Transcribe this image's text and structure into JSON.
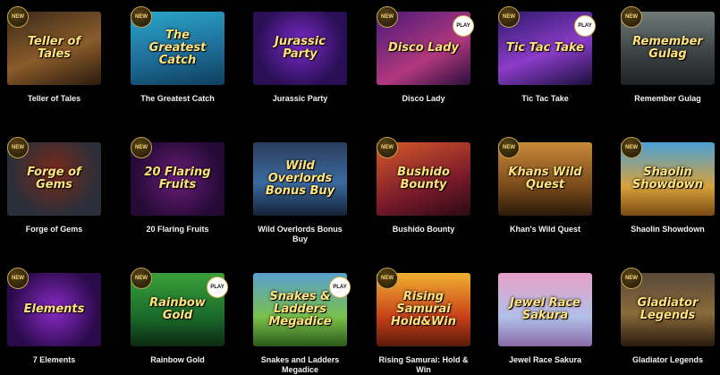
{
  "badges": {
    "new": "NEW",
    "play": "PLAY"
  },
  "games": [
    {
      "name": "Teller of Tales",
      "art_text": "Teller of Tales",
      "new": true,
      "play": false
    },
    {
      "name": "The Greatest Catch",
      "art_text": "The Greatest Catch",
      "new": true,
      "play": false
    },
    {
      "name": "Jurassic Party",
      "art_text": "Jurassic Party",
      "new": false,
      "play": false
    },
    {
      "name": "Disco Lady",
      "art_text": "Disco Lady",
      "new": true,
      "play": true
    },
    {
      "name": "Tic Tac Take",
      "art_text": "Tic Tac Take",
      "new": true,
      "play": true
    },
    {
      "name": "Remember Gulag",
      "art_text": "Remember Gulag",
      "new": true,
      "play": false
    },
    {
      "name": "Forge of Gems",
      "art_text": "Forge of Gems",
      "new": true,
      "play": false
    },
    {
      "name": "20 Flaring Fruits",
      "art_text": "20 Flaring Fruits",
      "new": true,
      "play": false
    },
    {
      "name": "Wild Overlords Bonus Buy",
      "art_text": "Wild Overlords Bonus Buy",
      "new": false,
      "play": false
    },
    {
      "name": "Bushido Bounty",
      "art_text": "Bushido Bounty",
      "new": true,
      "play": false
    },
    {
      "name": "Khan's Wild Quest",
      "art_text": "Khans Wild Quest",
      "new": true,
      "play": false
    },
    {
      "name": "Shaolin Showdown",
      "art_text": "Shaolin Showdown",
      "new": true,
      "play": false
    },
    {
      "name": "7 Elements",
      "art_text": "Elements",
      "new": true,
      "play": false
    },
    {
      "name": "Rainbow Gold",
      "art_text": "Rainbow Gold",
      "new": true,
      "play": true
    },
    {
      "name": "Snakes and Ladders Megadice",
      "art_text": "Snakes & Ladders Megadice",
      "new": false,
      "play": true
    },
    {
      "name": "Rising Samurai: Hold & Win",
      "art_text": "Rising Samurai Hold&Win",
      "new": true,
      "play": false
    },
    {
      "name": "Jewel Race Sakura",
      "art_text": "Jewel Race Sakura",
      "new": false,
      "play": false
    },
    {
      "name": "Gladiator Legends",
      "art_text": "Gladiator Legends",
      "new": true,
      "play": false
    }
  ]
}
